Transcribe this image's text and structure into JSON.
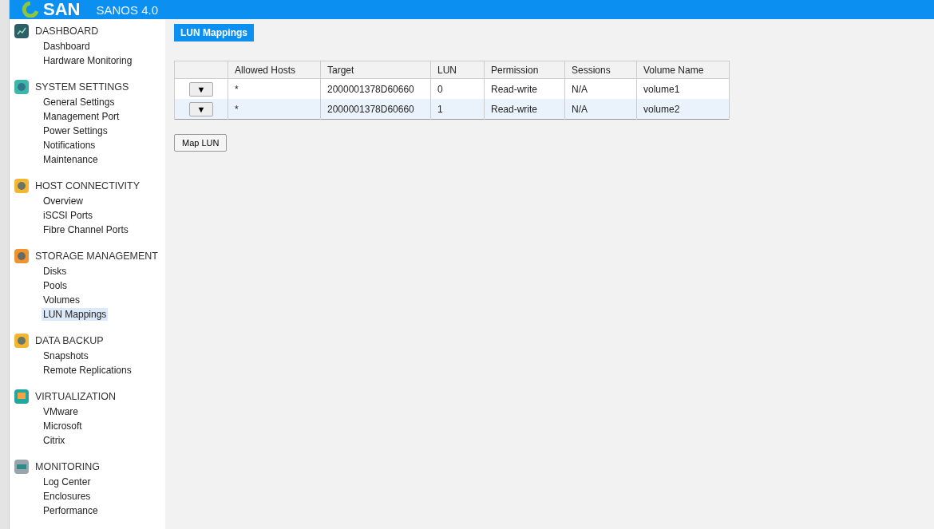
{
  "header": {
    "logo": "SAN",
    "product": "SANOS 4.0"
  },
  "sidebar": {
    "sections": [
      {
        "title": "DASHBOARD",
        "items": [
          {
            "label": "Dashboard",
            "selected": false
          },
          {
            "label": "Hardware Monitoring",
            "selected": false
          }
        ]
      },
      {
        "title": "SYSTEM SETTINGS",
        "items": [
          {
            "label": "General Settings",
            "selected": false
          },
          {
            "label": "Management Port",
            "selected": false
          },
          {
            "label": "Power Settings",
            "selected": false
          },
          {
            "label": "Notifications",
            "selected": false
          },
          {
            "label": "Maintenance",
            "selected": false
          }
        ]
      },
      {
        "title": "HOST CONNECTIVITY",
        "items": [
          {
            "label": "Overview",
            "selected": false
          },
          {
            "label": "iSCSI Ports",
            "selected": false
          },
          {
            "label": "Fibre Channel Ports",
            "selected": false
          }
        ]
      },
      {
        "title": "STORAGE MANAGEMENT",
        "items": [
          {
            "label": "Disks",
            "selected": false
          },
          {
            "label": "Pools",
            "selected": false
          },
          {
            "label": "Volumes",
            "selected": false
          },
          {
            "label": "LUN Mappings",
            "selected": true
          }
        ]
      },
      {
        "title": "DATA BACKUP",
        "items": [
          {
            "label": "Snapshots",
            "selected": false
          },
          {
            "label": "Remote Replications",
            "selected": false
          }
        ]
      },
      {
        "title": "VIRTUALIZATION",
        "items": [
          {
            "label": "VMware",
            "selected": false
          },
          {
            "label": "Microsoft",
            "selected": false
          },
          {
            "label": "Citrix",
            "selected": false
          }
        ]
      },
      {
        "title": "MONITORING",
        "items": [
          {
            "label": "Log Center",
            "selected": false
          },
          {
            "label": "Enclosures",
            "selected": false
          },
          {
            "label": "Performance",
            "selected": false
          }
        ]
      }
    ]
  },
  "page_tab": "LUN Mappings",
  "table": {
    "columns": [
      "",
      "Allowed Hosts",
      "Target",
      "LUN",
      "Permission",
      "Sessions",
      "Volume Name"
    ],
    "rows": [
      {
        "cells": [
          "▼",
          "*",
          "2000001378D60660",
          "0",
          "Read-write",
          "N/A",
          "volume1"
        ]
      },
      {
        "cells": [
          "▼",
          "*",
          "2000001378D60660",
          "1",
          "Read-write",
          "N/A",
          "volume2"
        ]
      }
    ]
  },
  "buttons": [
    "Map LUN"
  ]
}
